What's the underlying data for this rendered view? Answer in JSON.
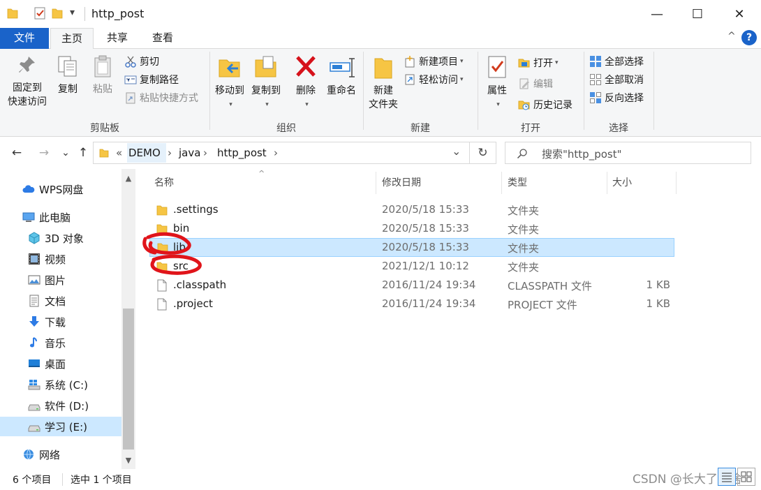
{
  "window": {
    "title": "http_post",
    "quick_access_dropdown": "▾",
    "minimize": "—",
    "maximize": "☐",
    "close": "✕"
  },
  "ribbon_tabs": [
    {
      "label": "文件"
    },
    {
      "label": "主页"
    },
    {
      "label": "共享"
    },
    {
      "label": "查看"
    }
  ],
  "ribbon_collapse": "^",
  "help": "?",
  "ribbon": {
    "clipboard": {
      "pin_line1": "固定到",
      "pin_line2": "快速访问",
      "copy": "复制",
      "paste": "粘贴",
      "cut": "剪切",
      "copy_path": "复制路径",
      "paste_shortcut": "粘贴快捷方式",
      "label": "剪贴板"
    },
    "organize": {
      "move_to": "移动到",
      "copy_to": "复制到",
      "delete": "删除",
      "rename": "重命名",
      "label": "组织"
    },
    "new": {
      "new_folder_line1": "新建",
      "new_folder_line2": "文件夹",
      "new_item": "新建项目",
      "easy_access": "轻松访问",
      "label": "新建"
    },
    "open": {
      "properties": "属性",
      "open": "打开",
      "edit": "编辑",
      "history": "历史记录",
      "label": "打开"
    },
    "select": {
      "select_all": "全部选择",
      "select_none": "全部取消",
      "invert": "反向选择",
      "label": "选择"
    }
  },
  "address": {
    "back": "←",
    "forward": "→",
    "recent": "⌄",
    "up": "↑",
    "overflow": "«",
    "crumbs": [
      "DEMO",
      "java",
      "http_post"
    ],
    "separator": "›",
    "dropdown": "⌄",
    "refresh": "↻",
    "search_placeholder": "搜索\"http_post\""
  },
  "nav_pane": {
    "items": [
      {
        "label": "WPS网盘",
        "icon": "cloud-icon"
      },
      {
        "label": "此电脑",
        "icon": "computer-icon"
      },
      {
        "label": "3D 对象",
        "icon": "3d-objects-icon"
      },
      {
        "label": "视频",
        "icon": "video-icon"
      },
      {
        "label": "图片",
        "icon": "pictures-icon"
      },
      {
        "label": "文档",
        "icon": "documents-icon"
      },
      {
        "label": "下载",
        "icon": "download-icon"
      },
      {
        "label": "音乐",
        "icon": "music-icon"
      },
      {
        "label": "桌面",
        "icon": "desktop-icon"
      },
      {
        "label": "系统 (C:)",
        "icon": "windows-drive-icon"
      },
      {
        "label": "软件 (D:)",
        "icon": "drive-icon"
      },
      {
        "label": "学习 (E:)",
        "icon": "drive-icon"
      },
      {
        "label": "网络",
        "icon": "network-icon"
      }
    ],
    "selected_index": 11,
    "scroll_up": "▲",
    "scroll_down": "▼"
  },
  "file_list": {
    "columns": [
      "名称",
      "修改日期",
      "类型",
      "大小"
    ],
    "sort_indicator": "^",
    "rows": [
      {
        "name": ".settings",
        "date": "2020/5/18 15:33",
        "type": "文件夹",
        "size": "",
        "icon": "folder-icon"
      },
      {
        "name": "bin",
        "date": "2020/5/18 15:33",
        "type": "文件夹",
        "size": "",
        "icon": "folder-icon"
      },
      {
        "name": "lib",
        "date": "2020/5/18 15:33",
        "type": "文件夹",
        "size": "",
        "icon": "folder-icon"
      },
      {
        "name": "src",
        "date": "2021/12/1 10:12",
        "type": "文件夹",
        "size": "",
        "icon": "folder-icon"
      },
      {
        "name": ".classpath",
        "date": "2016/11/24 19:34",
        "type": "CLASSPATH 文件",
        "size": "1 KB",
        "icon": "file-icon"
      },
      {
        "name": ".project",
        "date": "2016/11/24 19:34",
        "type": "PROJECT 文件",
        "size": "1 KB",
        "icon": "file-icon"
      }
    ],
    "selected_index": 2
  },
  "status": {
    "item_count": "6 个项目",
    "selected": "选中 1 个项目"
  },
  "watermark": "CSDN @长大了要啥",
  "colors": {
    "accent": "#1a63c9",
    "selection": "#cce8ff",
    "folder": "#f6c544",
    "annotation": "#e0141a"
  }
}
